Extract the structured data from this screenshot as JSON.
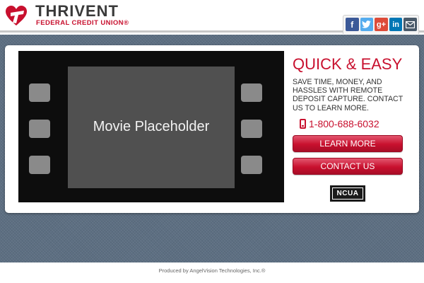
{
  "header": {
    "brand_name": "THRIVENT",
    "brand_sub": "FEDERAL CREDIT UNION®"
  },
  "social": [
    {
      "icon": "facebook-icon",
      "label": "f",
      "color": "#3b5998"
    },
    {
      "icon": "twitter-icon",
      "label": "",
      "color": "#55acee"
    },
    {
      "icon": "google-plus-icon",
      "label": "g+",
      "color": "#dd4b39"
    },
    {
      "icon": "linkedin-icon",
      "label": "in",
      "color": "#0077b5"
    },
    {
      "icon": "email-icon",
      "label": "",
      "color": "#4a5a6a"
    }
  ],
  "video": {
    "label": "Movie Placeholder"
  },
  "promo": {
    "title": "QUICK & EASY",
    "body": "SAVE TIME, MONEY, AND HASSLES WITH REMOTE DEPOSIT CAPTURE. CONTACT US TO LEARN MORE.",
    "phone": "1-800-688-6032",
    "learn_more": "LEARN MORE",
    "contact_us": "CONTACT US",
    "badge": "NCUA"
  },
  "colors": {
    "accent": "#c8102e",
    "background": "#5d6f82"
  },
  "footer": {
    "text": "Produced by AngelVision Technologies, Inc.®"
  }
}
